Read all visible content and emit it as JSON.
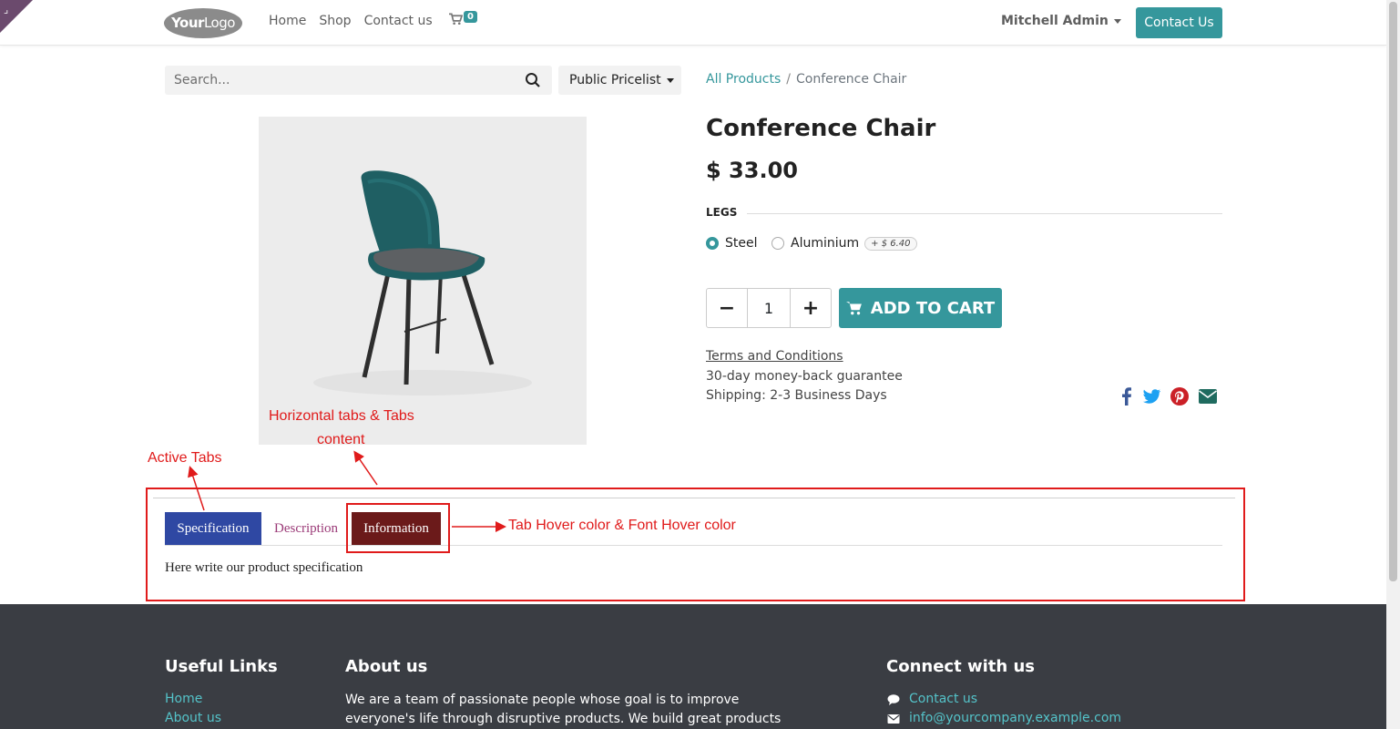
{
  "header": {
    "logo_text_a": "Your",
    "logo_text_b": "Logo",
    "nav": [
      "Home",
      "Shop",
      "Contact us"
    ],
    "cart_count": "0",
    "user_name": "Mitchell Admin",
    "contact_button": "Contact Us"
  },
  "search": {
    "placeholder": "Search...",
    "pricelist": "Public Pricelist"
  },
  "breadcrumb": {
    "root": "All Products",
    "separator": "/",
    "current": "Conference Chair"
  },
  "product": {
    "title": "Conference Chair",
    "price": "$ 33.00",
    "attribute_label": "LEGS",
    "options": [
      {
        "label": "Steel",
        "selected": true
      },
      {
        "label": "Aluminium",
        "selected": false,
        "extra": "+ $ 6.40"
      }
    ],
    "quantity": "1",
    "add_to_cart": "ADD TO CART",
    "terms": "Terms and Conditions",
    "guarantee": "30-day money-back guarantee",
    "shipping": "Shipping: 2-3 Business Days",
    "colors": {
      "accent": "#35979c",
      "chair": "#1f5f63"
    }
  },
  "social": [
    "facebook-icon",
    "twitter-icon",
    "pinterest-icon",
    "envelope-icon"
  ],
  "annotations": {
    "horizontal_tabs_1": "Horizontal tabs & Tabs",
    "horizontal_tabs_2": "content",
    "active_tabs": "Active Tabs",
    "hover": "Tab Hover color & Font Hover color",
    "color": "#e01b1b"
  },
  "tabs": {
    "items": [
      "Specification",
      "Description",
      "Information"
    ],
    "active": "Specification",
    "hovered": "Information",
    "content": "Here write our product specification",
    "colors": {
      "active_bg": "#2f48a3",
      "hover_bg": "#6b1a1a",
      "text": "#9b3b78"
    }
  },
  "footer": {
    "useful_links_title": "Useful Links",
    "useful_links": [
      "Home",
      "About us"
    ],
    "about_title": "About us",
    "about_text": "We are a team of passionate people whose goal is to improve everyone's life through disruptive products. We build great products to",
    "connect_title": "Connect with us",
    "connect": [
      "Contact us",
      "info@yourcompany.example.com"
    ]
  }
}
